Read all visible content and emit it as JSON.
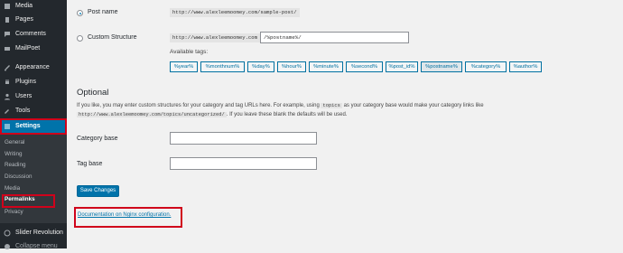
{
  "sidebar": {
    "items": [
      {
        "label": "Media",
        "icon": "media-icon"
      },
      {
        "label": "Pages",
        "icon": "page-icon"
      },
      {
        "label": "Comments",
        "icon": "comment-icon"
      },
      {
        "label": "MailPoet",
        "icon": "mail-icon"
      },
      {
        "label": "Appearance",
        "icon": "brush-icon"
      },
      {
        "label": "Plugins",
        "icon": "plugin-icon"
      },
      {
        "label": "Users",
        "icon": "user-icon"
      },
      {
        "label": "Tools",
        "icon": "wrench-icon"
      },
      {
        "label": "Settings",
        "icon": "settings-icon"
      }
    ],
    "submenu": [
      "General",
      "Writing",
      "Reading",
      "Discussion",
      "Media",
      "Permalinks",
      "Privacy"
    ],
    "bottom_items": [
      {
        "label": "Slider Revolution",
        "icon": "slider-icon"
      },
      {
        "label": "Collapse menu",
        "icon": "collapse-icon"
      }
    ]
  },
  "permalink": {
    "post_name_label": "Post name",
    "post_name_example": "http://www.alexleemoomey.com/sample-post/",
    "custom_label": "Custom Structure",
    "custom_prefix": "http://www.alexleemoomey.com",
    "custom_value": "/%postname%/",
    "available_tags_label": "Available tags:",
    "tags": [
      "%year%",
      "%monthnum%",
      "%day%",
      "%hour%",
      "%minute%",
      "%second%",
      "%post_id%",
      "%postname%",
      "%category%",
      "%author%"
    ]
  },
  "optional": {
    "heading": "Optional",
    "desc_part1": "If you like, you may enter custom structures for your category and tag URLs here. For example, using",
    "desc_code1": "topics",
    "desc_part2": "as your category base would make your category links like",
    "desc_code2": "http://www.alexleemoomey.com/topics/uncategorized/",
    "desc_part3": ". If you leave these blank the defaults will be used.",
    "category_base_label": "Category base",
    "category_base_value": "",
    "tag_base_label": "Tag base",
    "tag_base_value": ""
  },
  "save_label": "Save Changes",
  "doc_link": "Documentation on Nginx configuration.",
  "colors": {
    "accent": "#0073aa",
    "sidebar_bg": "#23282d",
    "highlight": "#d0021b"
  }
}
